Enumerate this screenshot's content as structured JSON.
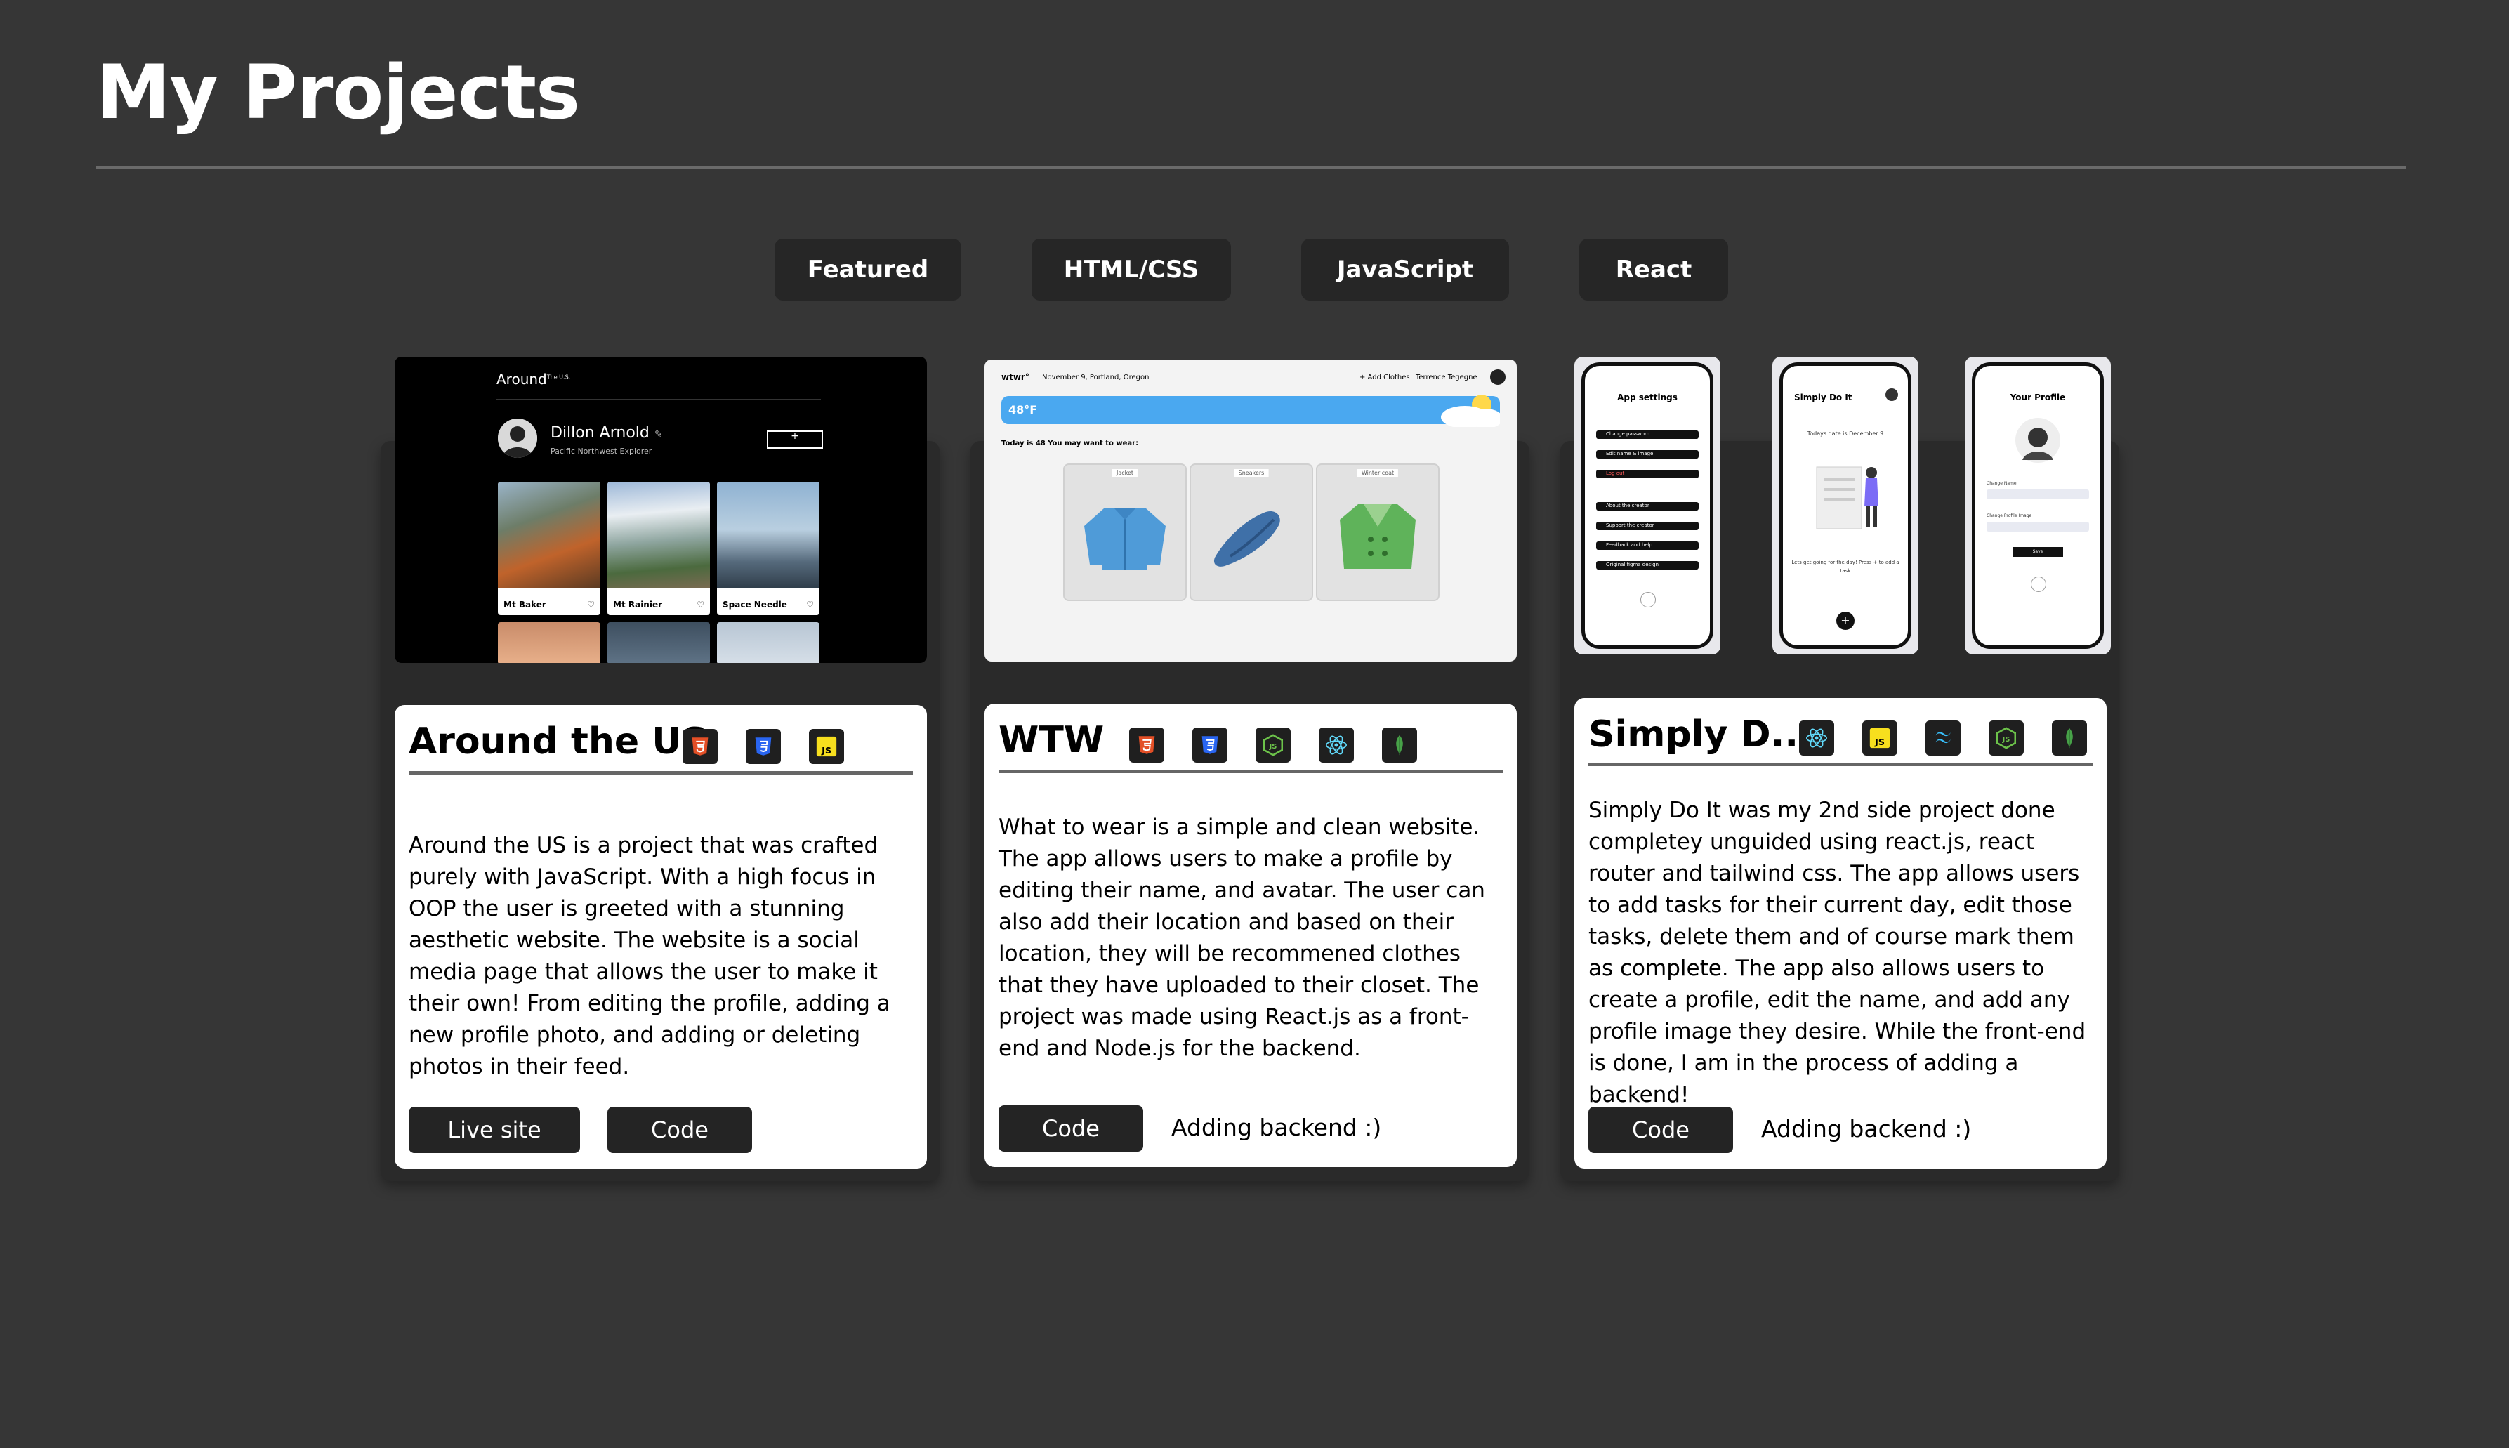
{
  "page": {
    "title": "My Projects"
  },
  "filters": [
    "Featured",
    "HTML/CSS",
    "JavaScript",
    "React"
  ],
  "projects": [
    {
      "title": "Around the US",
      "tech_icons": [
        "html5-icon",
        "css3-icon",
        "javascript-icon"
      ],
      "description": "Around the US is a project that was crafted purely with JavaScript. With a high focus in OOP the user is greeted with a stunning aesthetic website. The website is a social media page that allows the user to make it their own! From editing the profile, adding a new profile photo, and adding or deleting photos in their feed.",
      "buttons": [
        "Live site",
        "Code"
      ],
      "note": "",
      "preview": {
        "logo": "Around",
        "logo_suffix": "The U.S.",
        "profile_name": "Dillon Arnold",
        "profile_subtitle": "Pacific Northwest Explorer",
        "add_button": "+",
        "photos": [
          "Mt Baker",
          "Mt Rainier",
          "Space Needle"
        ]
      }
    },
    {
      "title": "WTW",
      "tech_icons": [
        "html5-icon",
        "css3-icon",
        "nodejs-icon",
        "react-icon",
        "mongodb-icon"
      ],
      "description": "What to wear is a simple and clean website. The app allows users to make a profile by editing their name, and avatar. The user can also add their location and based on their location, they will be recommened clothes that they have uploaded to their closet. The project was made using React.js as a front-end and Node.js for the backend.",
      "buttons": [
        "Code"
      ],
      "note": "Adding backend :)",
      "preview": {
        "logo": "wtwr°",
        "date_location": "November 9, Portland, Oregon",
        "add_clothes": "+ Add Clothes",
        "user_name": "Terrence Tegegne",
        "temperature": "48°F",
        "suggestion": "Today is 48 You may want to wear:",
        "items": [
          "Jacket",
          "Sneakers",
          "Winter coat"
        ]
      }
    },
    {
      "title": "Simply D...",
      "tech_icons": [
        "react-icon",
        "javascript-icon",
        "tailwind-icon",
        "nodejs-icon",
        "mongodb-icon"
      ],
      "description": "Simply Do It was my 2nd side project done completey unguided using react.js, react router and tailwind css. The app allows users to add tasks for their current day, edit those tasks, delete them and of course mark them as complete. The app also allows users to create a profile, edit the name, and add any profile image they desire. While the front-end is done, I am in the process of adding a backend!",
      "buttons": [
        "Code"
      ],
      "note": "Adding backend :)",
      "preview": {
        "screens": [
          "App settings",
          "Simply Do It",
          "Your Profile"
        ],
        "settings_items": [
          "Change password",
          "Edit name & image",
          "Log out",
          "About the creator",
          "Support the creator",
          "Feedback and help",
          "Original figma design"
        ],
        "todo_date": "Todays date is December 9",
        "todo_message": "Lets get going for the day! Press + to add a task",
        "profile_fields": [
          "Change Name",
          "Change Profile Image"
        ],
        "profile_button": "Save"
      }
    }
  ]
}
